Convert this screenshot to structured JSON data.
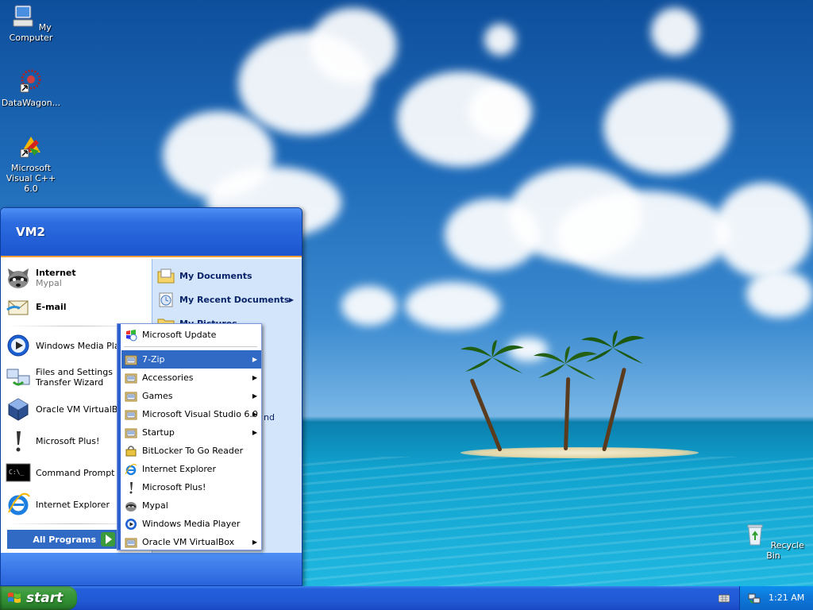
{
  "desktop": {
    "icons": [
      {
        "label": "My Computer",
        "icon": "my-computer-icon"
      },
      {
        "label": "DataWagon...",
        "icon": "datawagon-icon"
      },
      {
        "label": "Microsoft Visual C++ 6.0",
        "icon": "visual-cpp-icon"
      },
      {
        "label": "Recycle Bin",
        "icon": "recycle-bin-icon"
      }
    ]
  },
  "start_menu": {
    "user": "VM2",
    "pinned": [
      {
        "title": "Internet",
        "subtitle": "Mypal",
        "icon": "mypal-raccoon-icon"
      },
      {
        "title": "E-mail",
        "subtitle": "",
        "icon": "email-icon"
      }
    ],
    "recent": [
      {
        "label": "Windows Media Player",
        "icon": "media-player-icon"
      },
      {
        "label": "Files and Settings Transfer Wizard",
        "icon": "transfer-wizard-icon"
      },
      {
        "label": "Oracle VM VirtualBox",
        "icon": "virtualbox-icon"
      },
      {
        "label": "Microsoft Plus!",
        "icon": "microsoft-plus-icon"
      },
      {
        "label": "Command Prompt",
        "icon": "command-prompt-icon"
      },
      {
        "label": "Internet Explorer",
        "icon": "internet-explorer-icon"
      }
    ],
    "all_programs": "All Programs",
    "places": [
      {
        "label": "My Documents",
        "icon": "my-documents-icon",
        "arrow": false
      },
      {
        "label": "My Recent Documents",
        "icon": "recent-documents-icon",
        "arrow": true
      },
      {
        "label": "My Pictures",
        "icon": "my-pictures-icon",
        "arrow": false
      }
    ],
    "places_fragment": "nd"
  },
  "programs_menu": {
    "items": [
      {
        "label": "Microsoft Update",
        "icon": "windows-update-icon",
        "submenu": false,
        "selected": false
      },
      {
        "label": "7-Zip",
        "icon": "program-folder-icon",
        "submenu": true,
        "selected": true
      },
      {
        "label": "Accessories",
        "icon": "program-folder-icon",
        "submenu": true,
        "selected": false
      },
      {
        "label": "Games",
        "icon": "program-folder-icon",
        "submenu": true,
        "selected": false
      },
      {
        "label": "Microsoft Visual Studio 6.0",
        "icon": "program-folder-icon",
        "submenu": true,
        "selected": false
      },
      {
        "label": "Startup",
        "icon": "program-folder-icon",
        "submenu": true,
        "selected": false
      },
      {
        "label": "BitLocker To Go Reader",
        "icon": "bitlocker-icon",
        "submenu": false,
        "selected": false
      },
      {
        "label": "Internet Explorer",
        "icon": "internet-explorer-icon",
        "submenu": false,
        "selected": false
      },
      {
        "label": "Microsoft Plus!",
        "icon": "microsoft-plus-icon",
        "submenu": false,
        "selected": false
      },
      {
        "label": "Mypal",
        "icon": "mypal-raccoon-icon",
        "submenu": false,
        "selected": false
      },
      {
        "label": "Windows Media Player",
        "icon": "media-player-icon",
        "submenu": false,
        "selected": false
      },
      {
        "label": "Oracle VM VirtualBox",
        "icon": "program-folder-icon",
        "submenu": true,
        "selected": false
      }
    ]
  },
  "taskbar": {
    "start_label": "start",
    "clock": "1:21 AM"
  },
  "colors": {
    "selection": "#316ac5",
    "taskbar_blue": "#245edb",
    "start_green": "#3b9a3c"
  }
}
